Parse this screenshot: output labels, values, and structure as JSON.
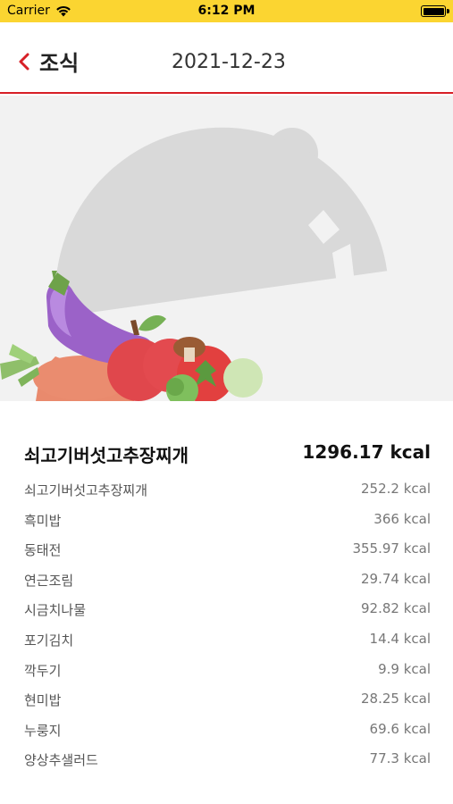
{
  "status": {
    "carrier": "Carrier",
    "time": "6:12 PM"
  },
  "nav": {
    "back_label": "조식",
    "date": "2021-12-23"
  },
  "colors": {
    "status_bar": "#fbd531",
    "accent_red": "#d71f26",
    "hero_bg": "#f2f2f2"
  },
  "summary": {
    "name": "쇠고기버섯고추장찌개",
    "kcal": "1296.17 kcal"
  },
  "menu_items": [
    {
      "name": "쇠고기버섯고추장찌개",
      "kcal": "252.2 kcal"
    },
    {
      "name": "흑미밥",
      "kcal": "366 kcal"
    },
    {
      "name": "동태전",
      "kcal": "355.97 kcal"
    },
    {
      "name": "연근조림",
      "kcal": "29.74 kcal"
    },
    {
      "name": "시금치나물",
      "kcal": "92.82 kcal"
    },
    {
      "name": "포기김치",
      "kcal": "14.4 kcal"
    },
    {
      "name": "깍두기",
      "kcal": "9.9 kcal"
    },
    {
      "name": "현미밥",
      "kcal": "28.25 kcal"
    },
    {
      "name": "누룽지",
      "kcal": "69.6 kcal"
    },
    {
      "name": "양상추샐러드",
      "kcal": "77.3 kcal"
    }
  ]
}
